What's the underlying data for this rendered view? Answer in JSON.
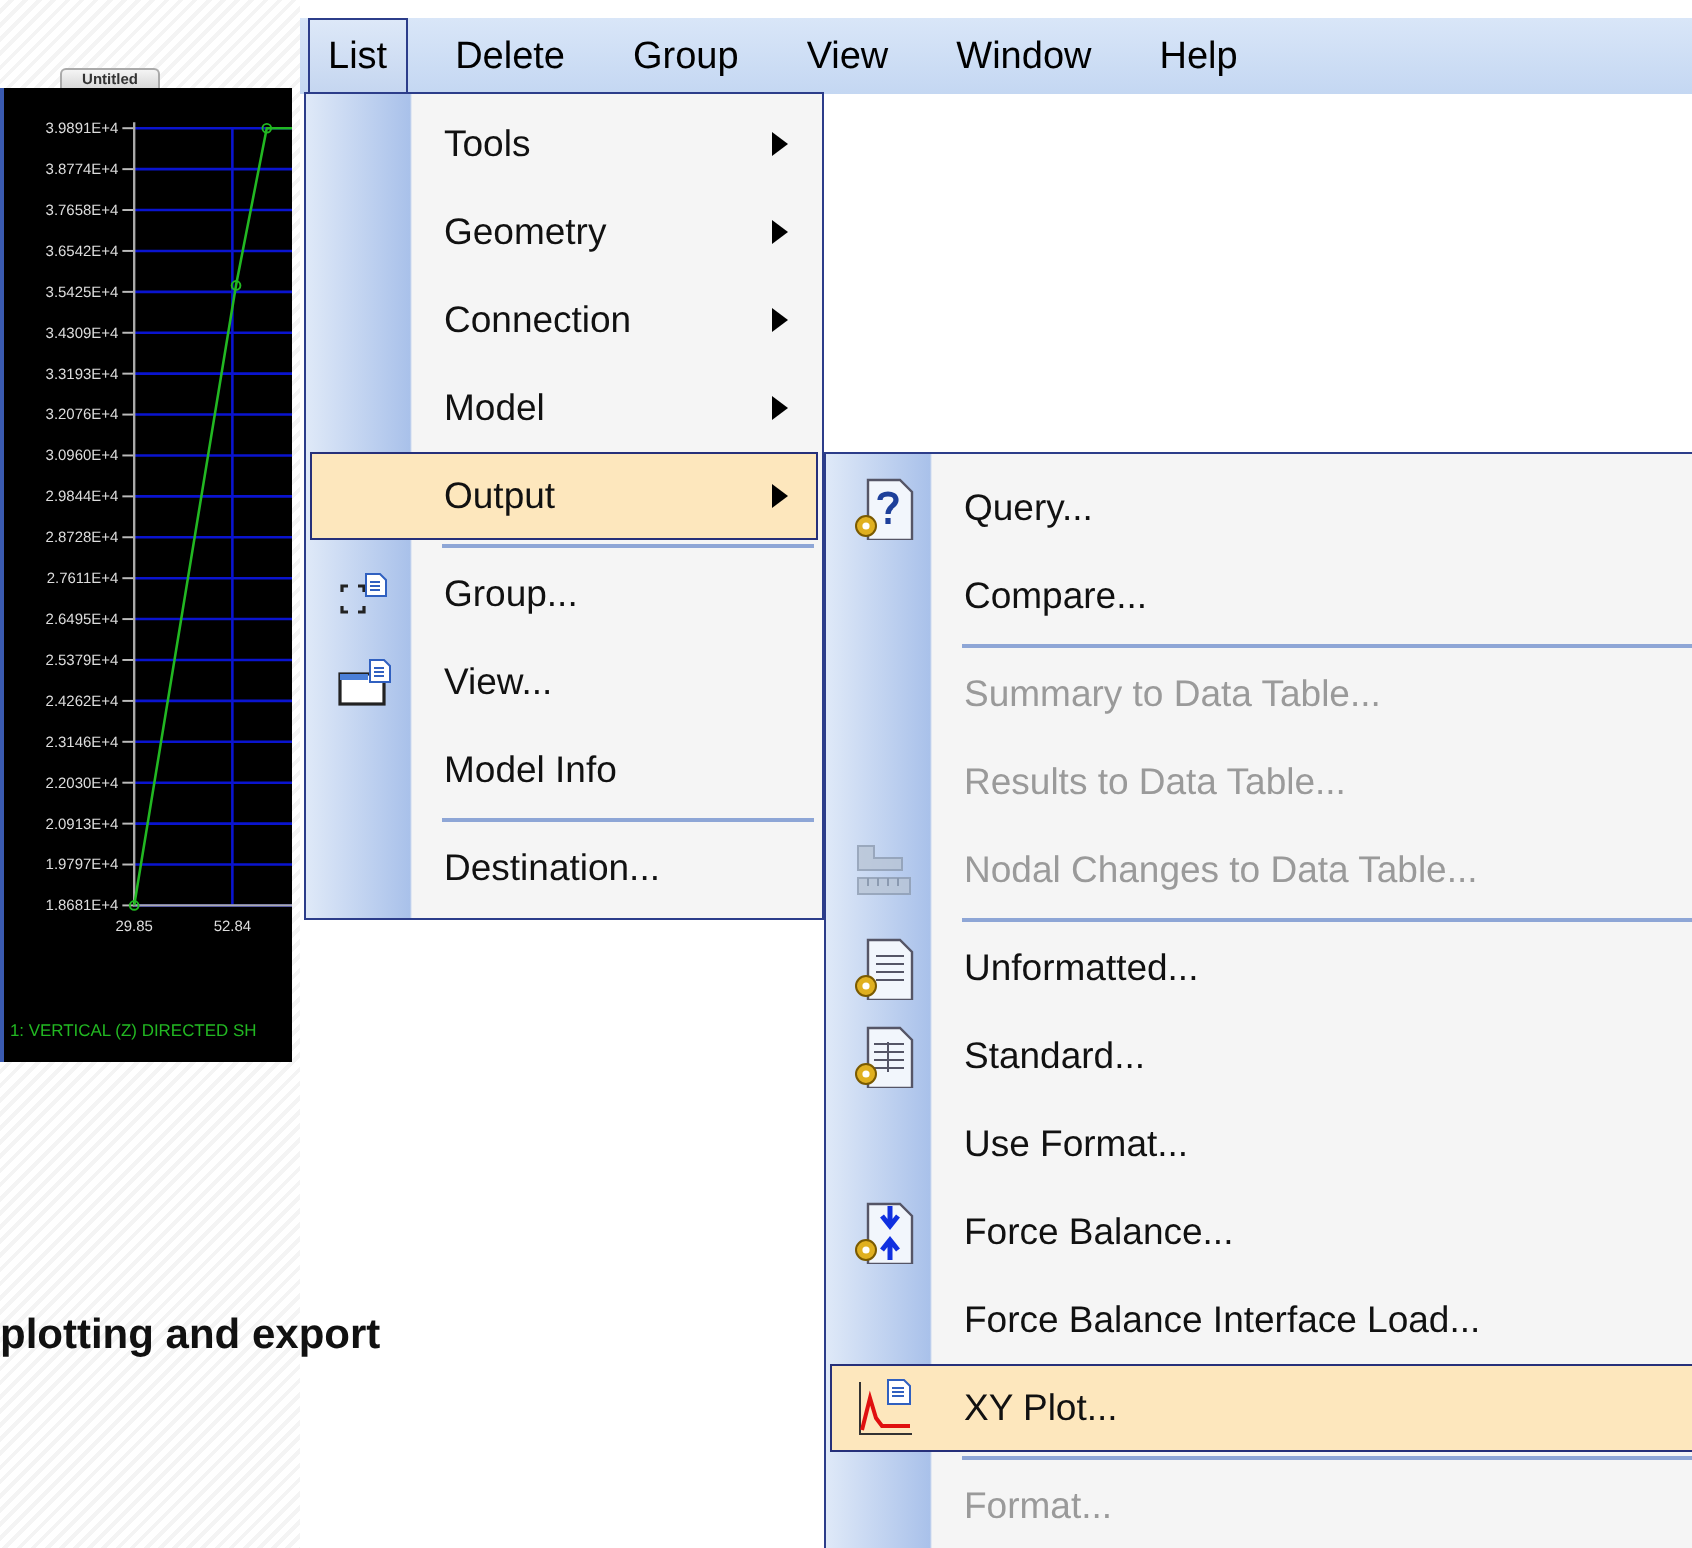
{
  "plot_window": {
    "tab": "Untitled",
    "chart_data": {
      "type": "line",
      "grid": true,
      "x": [
        29.85,
        53.7,
        60.9,
        66.8
      ],
      "series": [
        {
          "name": "1: VERTICAL (Z) DIRECTED SH",
          "color": "#22b822",
          "values": [
            18681,
            35600,
            39891,
            39891
          ]
        }
      ],
      "xlim": [
        29.85,
        66.8
      ],
      "ylim": [
        18681,
        39891
      ],
      "xticks": [
        {
          "value": 29.85,
          "label": "29.85"
        },
        {
          "value": 52.84,
          "label": "52.84"
        }
      ],
      "yticks": [
        {
          "value": 39891,
          "label": "3.9891E+4"
        },
        {
          "value": 38774,
          "label": "3.8774E+4"
        },
        {
          "value": 37658,
          "label": "3.7658E+4"
        },
        {
          "value": 36542,
          "label": "3.6542E+4"
        },
        {
          "value": 35425,
          "label": "3.5425E+4"
        },
        {
          "value": 34309,
          "label": "3.4309E+4"
        },
        {
          "value": 33193,
          "label": "3.3193E+4"
        },
        {
          "value": 32076,
          "label": "3.2076E+4"
        },
        {
          "value": 30960,
          "label": "3.0960E+4"
        },
        {
          "value": 29844,
          "label": "2.9844E+4"
        },
        {
          "value": 28728,
          "label": "2.8728E+4"
        },
        {
          "value": 27611,
          "label": "2.7611E+4"
        },
        {
          "value": 26495,
          "label": "2.6495E+4"
        },
        {
          "value": 25379,
          "label": "2.5379E+4"
        },
        {
          "value": 24262,
          "label": "2.4262E+4"
        },
        {
          "value": 23146,
          "label": "2.3146E+4"
        },
        {
          "value": 22030,
          "label": "2.2030E+4"
        },
        {
          "value": 20913,
          "label": "2.0913E+4"
        },
        {
          "value": 19797,
          "label": "1.9797E+4"
        },
        {
          "value": 18681,
          "label": "1.8681E+4"
        }
      ]
    }
  },
  "menu_bar": [
    {
      "label": "List",
      "selected": true
    },
    {
      "label": "Delete",
      "selected": false
    },
    {
      "label": "Group",
      "selected": false
    },
    {
      "label": "View",
      "selected": false
    },
    {
      "label": "Window",
      "selected": false
    },
    {
      "label": "Help",
      "selected": false
    }
  ],
  "list_menu": [
    {
      "kind": "submenu",
      "label": "Tools",
      "selected": false
    },
    {
      "kind": "submenu",
      "label": "Geometry",
      "selected": false
    },
    {
      "kind": "submenu",
      "label": "Connection",
      "selected": false
    },
    {
      "kind": "submenu",
      "label": "Model",
      "selected": false
    },
    {
      "kind": "submenu",
      "label": "Output",
      "selected": true
    },
    {
      "kind": "separator"
    },
    {
      "kind": "item",
      "label": "Group...",
      "selected": false
    },
    {
      "kind": "item",
      "label": "View...",
      "selected": false
    },
    {
      "kind": "item",
      "label": "Model Info",
      "selected": false
    },
    {
      "kind": "separator"
    },
    {
      "kind": "item",
      "label": "Destination...",
      "selected": false
    }
  ],
  "output_submenu": [
    {
      "kind": "item",
      "label": "Query...",
      "disabled": false,
      "selected": false
    },
    {
      "kind": "item",
      "label": "Compare...",
      "disabled": false,
      "selected": false
    },
    {
      "kind": "separator"
    },
    {
      "kind": "item",
      "label": "Summary to Data Table...",
      "disabled": true,
      "selected": false
    },
    {
      "kind": "item",
      "label": "Results to Data Table...",
      "disabled": true,
      "selected": false
    },
    {
      "kind": "item",
      "label": "Nodal Changes to Data Table...",
      "disabled": true,
      "selected": false
    },
    {
      "kind": "separator"
    },
    {
      "kind": "item",
      "label": "Unformatted...",
      "disabled": false,
      "selected": false
    },
    {
      "kind": "item",
      "label": "Standard...",
      "disabled": false,
      "selected": false
    },
    {
      "kind": "item",
      "label": "Use Format...",
      "disabled": false,
      "selected": false
    },
    {
      "kind": "item",
      "label": "Force Balance...",
      "disabled": false,
      "selected": false
    },
    {
      "kind": "item",
      "label": "Force Balance Interface Load...",
      "disabled": false,
      "selected": false
    },
    {
      "kind": "item",
      "label": "XY Plot...",
      "disabled": false,
      "selected": true
    },
    {
      "kind": "separator"
    },
    {
      "kind": "item",
      "label": "Format...",
      "disabled": true,
      "selected": false
    }
  ],
  "caption": "plotting and export"
}
